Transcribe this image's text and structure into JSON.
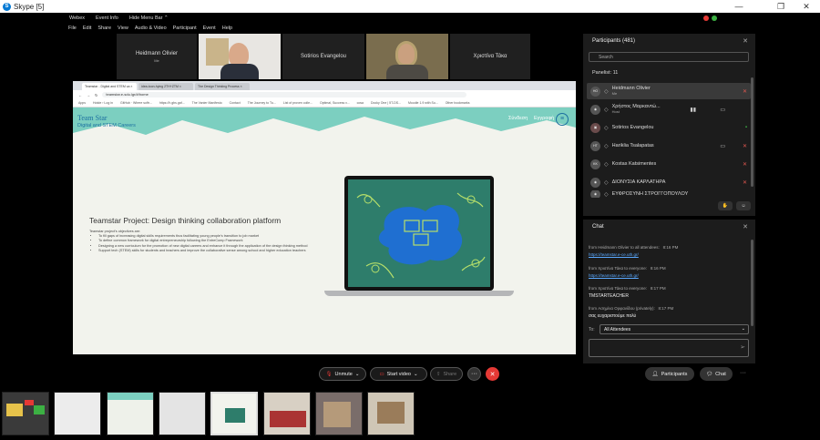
{
  "skype": {
    "title": "Skype [5]",
    "minimize": "—",
    "maximize": "❐",
    "close": "✕"
  },
  "webex": {
    "app": "Webex",
    "event_info": "Event Info",
    "hide_menu_bar": "Hide Menu Bar ⌃",
    "menu": [
      "File",
      "Edit",
      "Share",
      "View",
      "Audio & Video",
      "Participant",
      "Event",
      "Help"
    ]
  },
  "tiles": [
    {
      "name": "Heidmann Olivier",
      "role": "Me"
    },
    {
      "name": "Sotirios Evangelou"
    },
    {
      "name": "Χριστίνα Τάκα"
    }
  ],
  "browser": {
    "tabs": [
      "Teamstar - Digital and STEM ca ×",
      "idea-toon-hying 2TH+ZTM ×",
      "The Design Thinking Process ×"
    ],
    "url": "teamstar.e-sdu.lgr/#/home",
    "bookmarks": [
      "Apps",
      "Hotde › Log in",
      "GitHub · Where softr...",
      "https://h.gbs.gaf...",
      "The Vanier Manifesto",
      "Contact",
      "The Journey to Tu...",
      "List of proven colle...",
      "Optimal, Success v...",
      "cosa",
      "Docky One | 5T-DS...",
      "Moodle 1.9 with Su...",
      "Other bookmarks"
    ]
  },
  "site": {
    "brand": "Team Star",
    "tagline": "Digital and STEM Careers",
    "nav": [
      "Σύνδεση",
      "Εγγραφή"
    ],
    "heading": "Teamstar Project: Design thinking collaboration platform",
    "intro": "Teamstar project's objectives are:",
    "objectives": [
      "To fill gaps of increasing digital skills requirements thus facilitating young people's transition to job market",
      "To define common framework for digital entrepreneurship following the EntreComp Framework",
      "Designing a new curriculum for the promotion of new digital careers and enhance it through the application of the design thinking method",
      "Support tech (STEM) skills for students and teachers and improve the collaborative sense among school and higher education teachers"
    ]
  },
  "participants": {
    "title": "Participants (481)",
    "search_placeholder": "Search",
    "section": "Panelist: 11",
    "list": [
      {
        "initials": "HO",
        "name": "Heidmann Olivier",
        "role": "Me"
      },
      {
        "initials": "",
        "name": "Χρήστος Μαρκαντώ...",
        "role": "Host"
      },
      {
        "initials": "",
        "name": "Sotirios Evangelou",
        "role": ""
      },
      {
        "initials": "HT",
        "name": "Hariklia Tsalapatas",
        "role": ""
      },
      {
        "initials": "KK",
        "name": "Kostas Katsimentes",
        "role": ""
      },
      {
        "initials": "",
        "name": "ΔΙΟΝΥΣΙΑ ΚΑΡΛΑΤΗΡΑ",
        "role": ""
      },
      {
        "initials": "",
        "name": "ΕΥΦΡΟΣΥΝΗ ΣΤΡΟΓΓΟΠΟΥΛΟΥ",
        "role": ""
      }
    ]
  },
  "chat": {
    "title": "Chat",
    "messages": [
      {
        "from": "from Heidmann Olivier to all attendees:",
        "time": "8:16 PM",
        "link": "https://teamstar.e-ce.uth.gr/"
      },
      {
        "from": "from Χριστίνα Τάκα to everyone:",
        "time": "8:16 PM",
        "link": "https://teamstar.e-ce.uth.gr/"
      },
      {
        "from": "from Χριστίνα Τάκα to everyone:",
        "time": "8:17 PM",
        "text": "TMSTARTEACHER"
      },
      {
        "from": "from Ασημίνα Ορφανίδου (privately):",
        "time": "8:17 PM",
        "text": "σας ευχαριστούμε πολύ"
      }
    ],
    "to_label": "To:",
    "to_value": "All Attendees"
  },
  "controls": {
    "mute": "Unmute",
    "video": "Start video",
    "share": "Share",
    "more": "···",
    "participants": "Participants",
    "chat": "Chat",
    "overflow": "···"
  },
  "colors": {
    "end_red": "#e53935",
    "accent_blue": "#0078d4",
    "site_teal": "#7ccfc0",
    "brand_blue": "#1b6fa0"
  }
}
